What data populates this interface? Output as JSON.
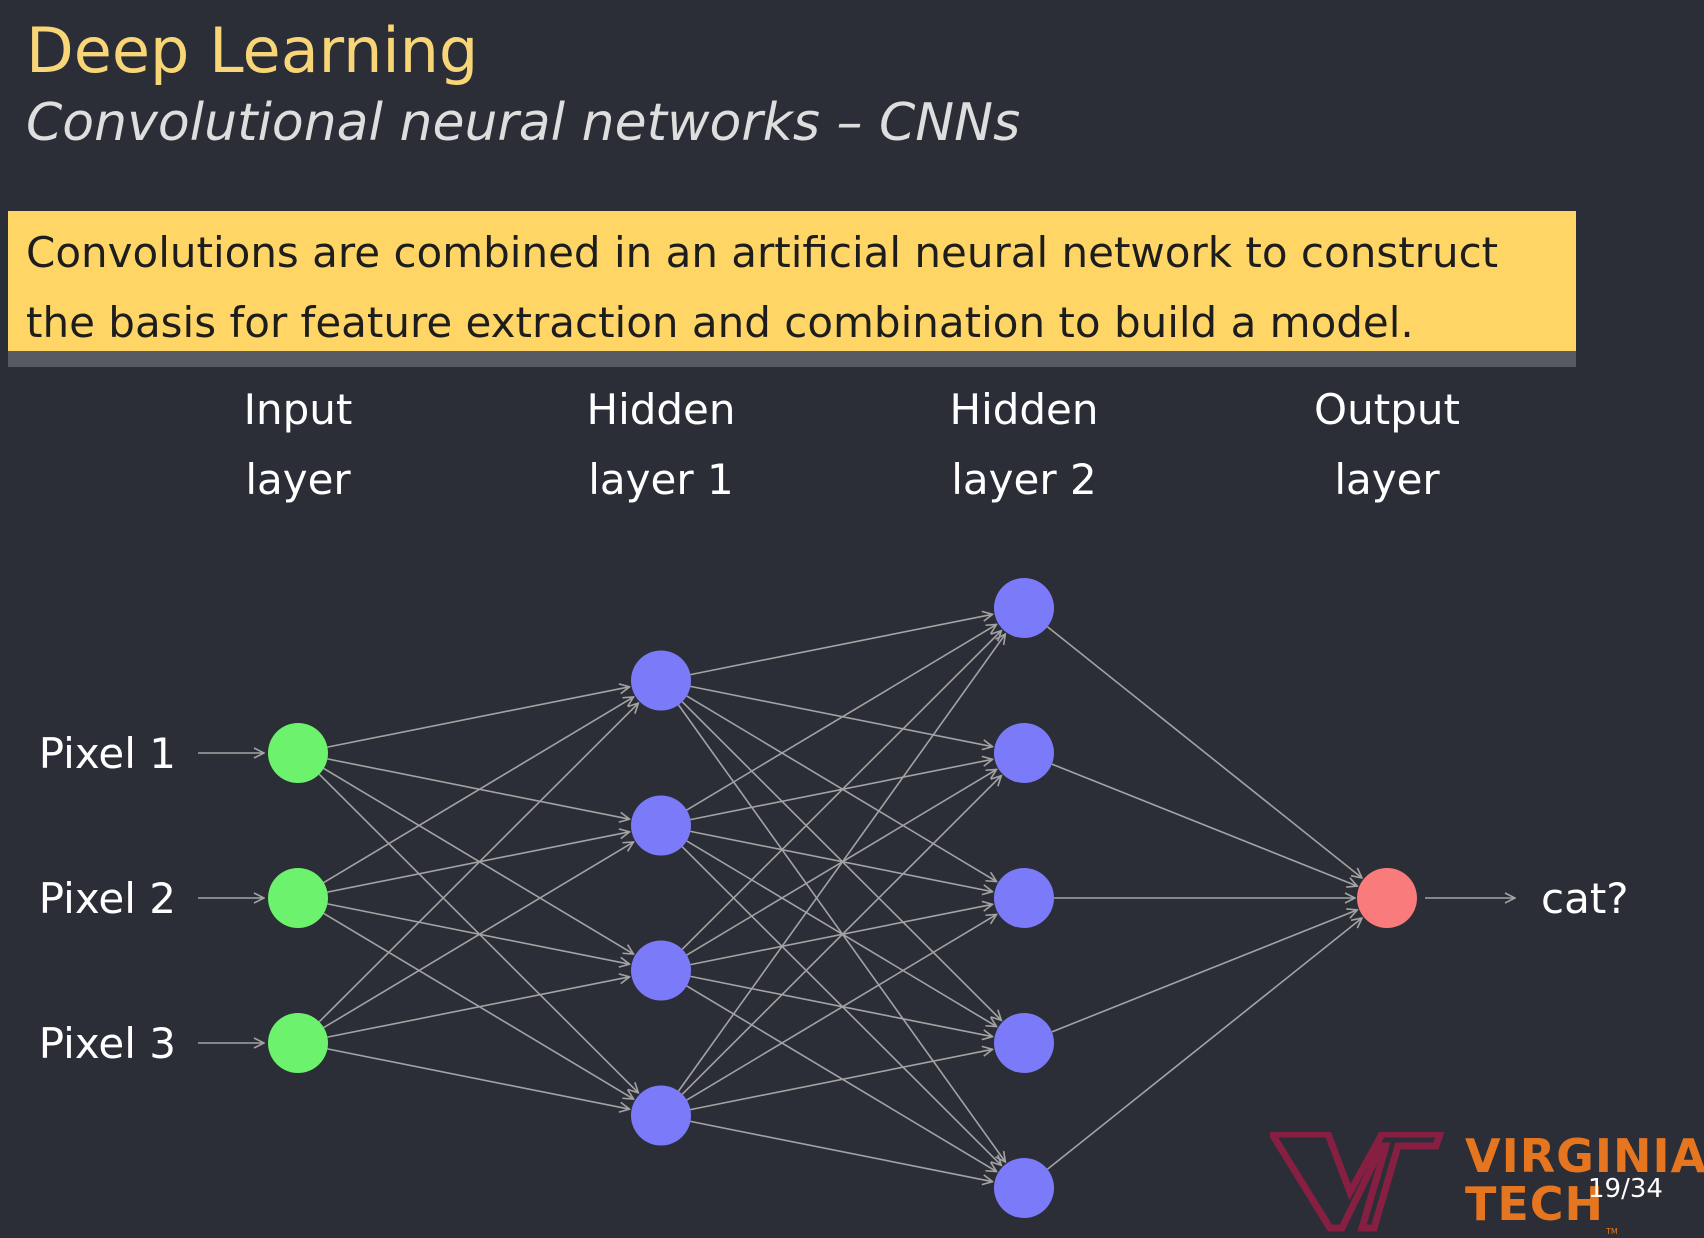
{
  "slide": {
    "title": "Deep Learning",
    "subtitle": "Convolutional neural networks – CNNs",
    "page_number": "19/34"
  },
  "callout": {
    "text": "Convolutions are combined in an artificial neural network to construct the basis for feature extraction and combination to build a model."
  },
  "network": {
    "layers": [
      {
        "header_line1": "Input",
        "header_line2": "layer",
        "nodes": 3,
        "color": "#6cf26c"
      },
      {
        "header_line1": "Hidden",
        "header_line2": "layer 1",
        "nodes": 4,
        "color": "#7b7bfa"
      },
      {
        "header_line1": "Hidden",
        "header_line2": "layer 2",
        "nodes": 5,
        "color": "#7b7bfa"
      },
      {
        "header_line1": "Output",
        "header_line2": "layer",
        "nodes": 1,
        "color": "#fa7b7b"
      }
    ],
    "inputs": [
      "Pixel 1",
      "Pixel 2",
      "Pixel 3"
    ],
    "output_label": "cat?",
    "edge_color": "#a3a3a3",
    "connectivity": "fully-connected"
  },
  "logo": {
    "line1": "VIRGINIA",
    "line2": "TECH",
    "trademark": "TM",
    "brand_maroon": "#861f41",
    "brand_orange": "#e5751f"
  }
}
